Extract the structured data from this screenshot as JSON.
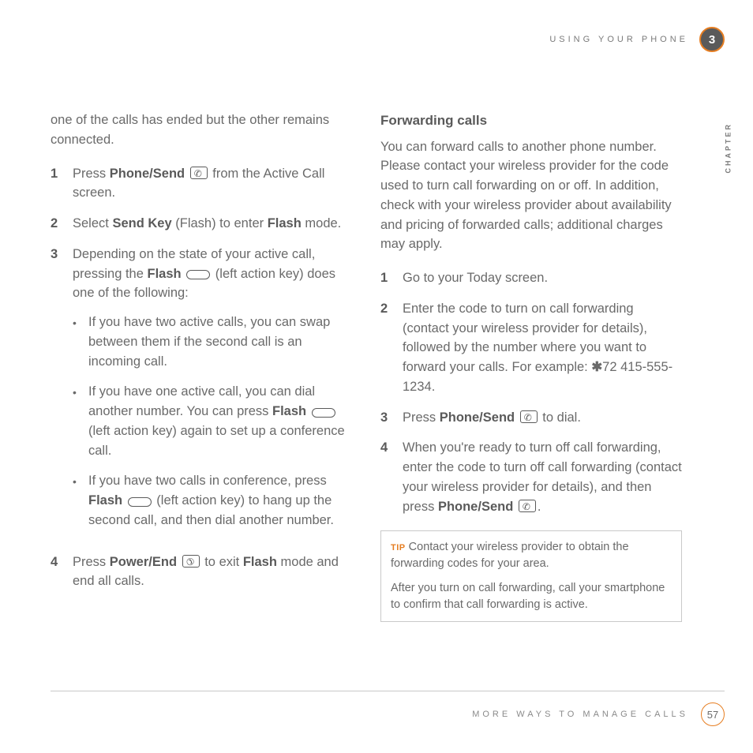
{
  "header": {
    "title": "USING YOUR PHONE",
    "chapter_number": "3",
    "chapter_label": "CHAPTER"
  },
  "left": {
    "intro": "one of the calls has ended but the other remains connected.",
    "s1": {
      "num": "1",
      "a": "Press ",
      "b": "Phone/Send",
      "c": " from the Active Call screen."
    },
    "s2": {
      "num": "2",
      "a": "Select ",
      "b": "Send Key",
      "c": " (Flash) to enter ",
      "d": "Flash",
      "e": " mode."
    },
    "s3": {
      "num": "3",
      "a": "Depending on the state of your active call, pressing the ",
      "b": "Flash",
      "c": " (left action key) does one of the following:"
    },
    "b1": "If you have two active calls, you can swap between them if the second call is an incoming call.",
    "b2": {
      "a": "If you have one active call, you can dial another number. You can press ",
      "b": "Flash",
      "c": " (left action key) again to set up a conference call."
    },
    "b3": {
      "a": "If you have two calls in conference, press ",
      "b": "Flash",
      "c": " (left action key) to hang up the second call, and then dial another number."
    },
    "s4": {
      "num": "4",
      "a": "Press ",
      "b": "Power/End",
      "c": " to exit ",
      "d": "Flash",
      "e": " mode and end all calls."
    }
  },
  "right": {
    "heading": "Forwarding calls",
    "intro": "You can forward calls to another phone number. Please contact your wireless provider for the code used to turn call forwarding on or off. In addition, check with your wireless provider about availability and pricing of forwarded calls; additional charges may apply.",
    "s1": {
      "num": "1",
      "a": "Go to your Today screen."
    },
    "s2": {
      "num": "2",
      "a": "Enter the code to turn on call forwarding (contact your wireless provider for details), followed by the number where you want to forward your calls. For example: ",
      "star": "✱",
      "ex": "72 415-555-1234."
    },
    "s3": {
      "num": "3",
      "a": "Press ",
      "b": "Phone/Send",
      "c": " to dial."
    },
    "s4": {
      "num": "4",
      "a": "When you're ready to turn off call forwarding, enter the code to turn off call forwarding (contact your wireless provider for details), and then press ",
      "b": "Phone/Send",
      "c": "."
    },
    "tip": {
      "label": "TIP",
      "p1": " Contact your wireless provider to obtain the forwarding codes for your area.",
      "p2": "After you turn on call forwarding, call your smartphone to confirm that call forwarding is active."
    }
  },
  "footer": {
    "text": "MORE WAYS TO MANAGE CALLS",
    "page": "57"
  }
}
